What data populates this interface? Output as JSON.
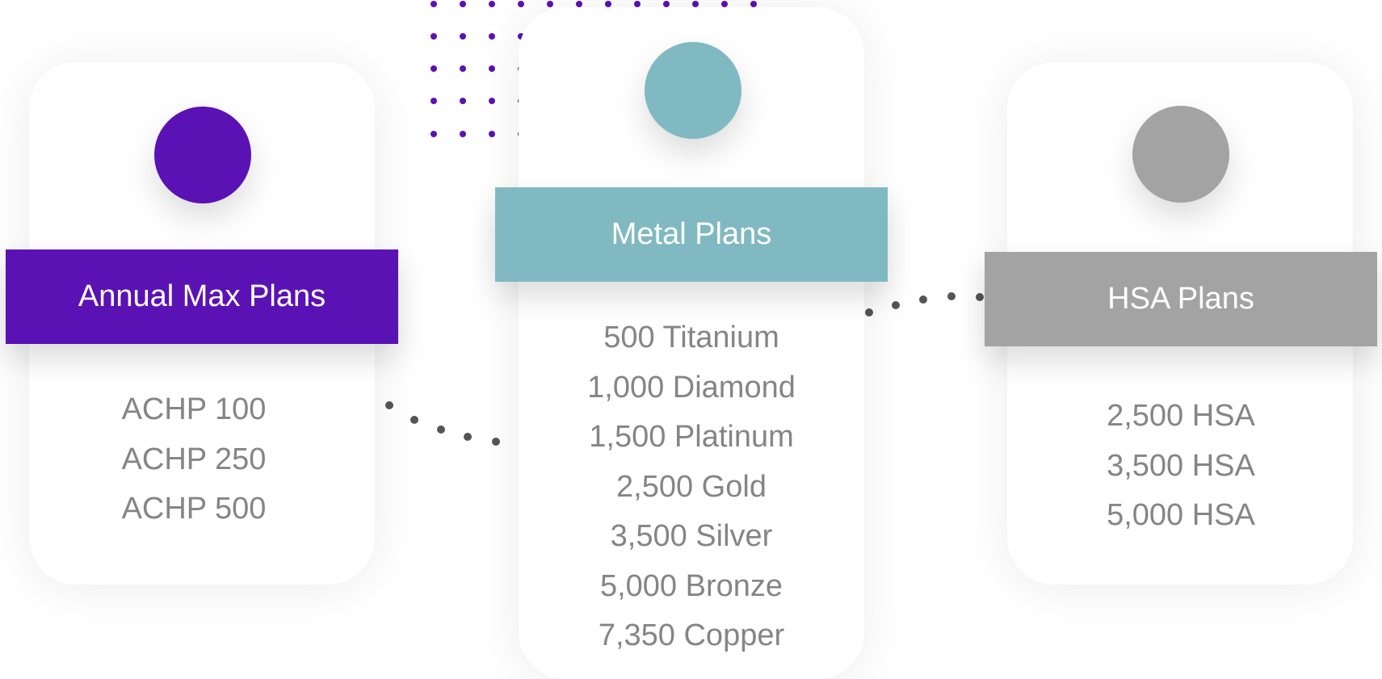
{
  "colors": {
    "annual": "#5b12b4",
    "metal": "#80b9c1",
    "hsa": "#a3a3a3",
    "text": "#858585",
    "dots": "#5b12b4",
    "connector": "#555555"
  },
  "cards": {
    "annual": {
      "title": "Annual Max Plans",
      "items": [
        "ACHP 100",
        "ACHP 250",
        "ACHP 500"
      ]
    },
    "metal": {
      "title": "Metal Plans",
      "items": [
        "500 Titanium",
        "1,000 Diamond",
        "1,500 Platinum",
        "2,500 Gold",
        "3,500 Silver",
        "5,000 Bronze",
        "7,350 Copper"
      ]
    },
    "hsa": {
      "title": "HSA Plans",
      "items": [
        "2,500 HSA",
        "3,500 HSA",
        "5,000 HSA"
      ]
    }
  }
}
